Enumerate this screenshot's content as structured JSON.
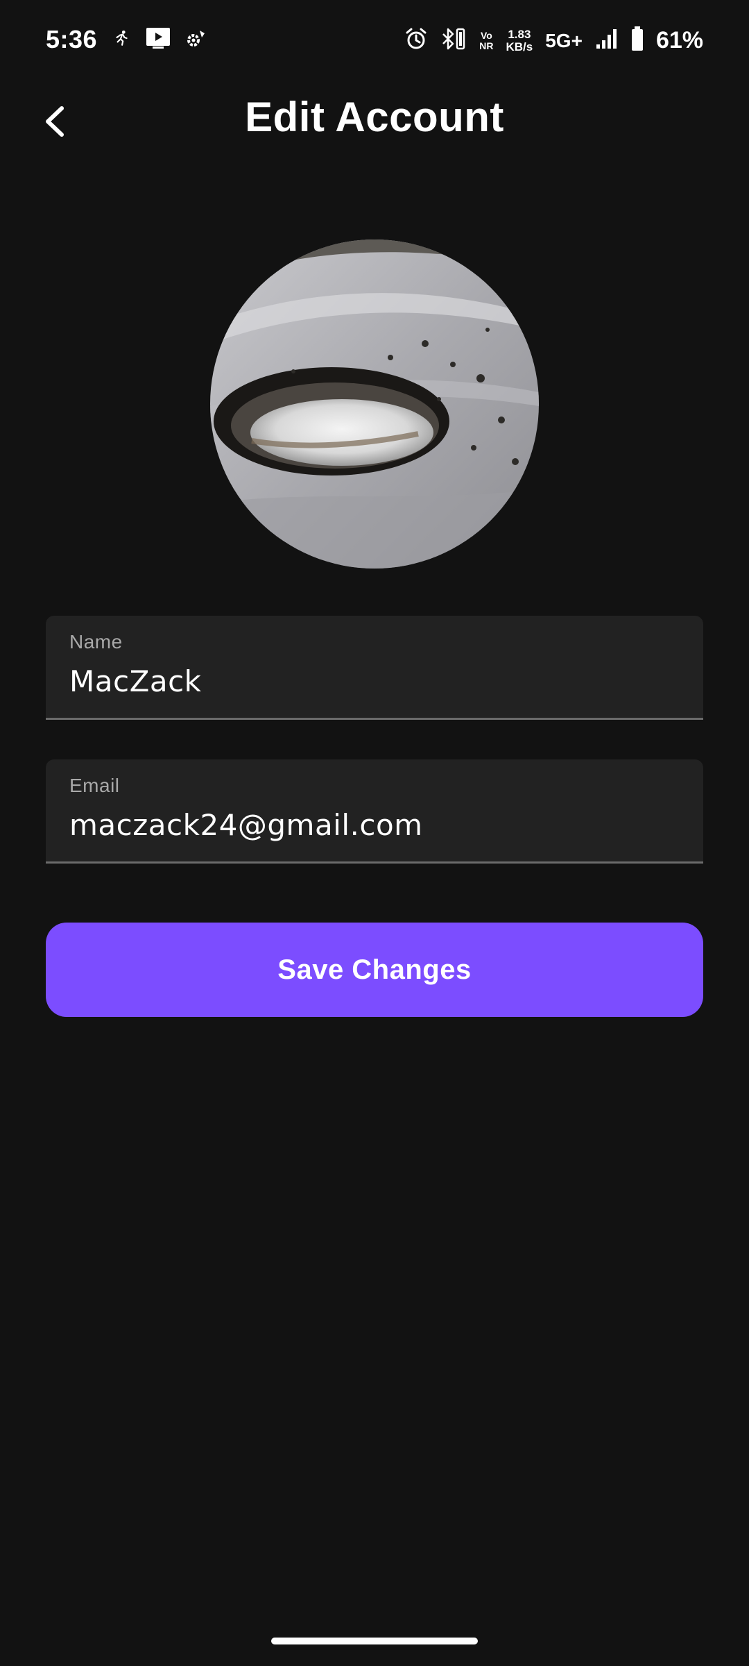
{
  "status_bar": {
    "time": "5:36",
    "net_speed_value": "1.83",
    "net_speed_unit": "KB/s",
    "vonr_top": "Vo",
    "vonr_bottom": "NR",
    "network_type": "5G+",
    "battery_percent": "61%",
    "icons": [
      "running-icon",
      "video-icon",
      "settings-sync-icon",
      "alarm-icon",
      "bluetooth-vibrate-icon",
      "signal-icon",
      "battery-icon"
    ]
  },
  "header": {
    "title": "Edit Account",
    "back_icon": "chevron-left-icon"
  },
  "avatar": {
    "description_icon": "profile-photo"
  },
  "form": {
    "name_label": "Name",
    "name_value": "MacZack",
    "email_label": "Email",
    "email_value": "maczack24@gmail.com"
  },
  "save_button_label": "Save Changes",
  "colors": {
    "background": "#121212",
    "field_background": "#222222",
    "accent": "#7c4dff",
    "label": "#a9a9a9"
  }
}
